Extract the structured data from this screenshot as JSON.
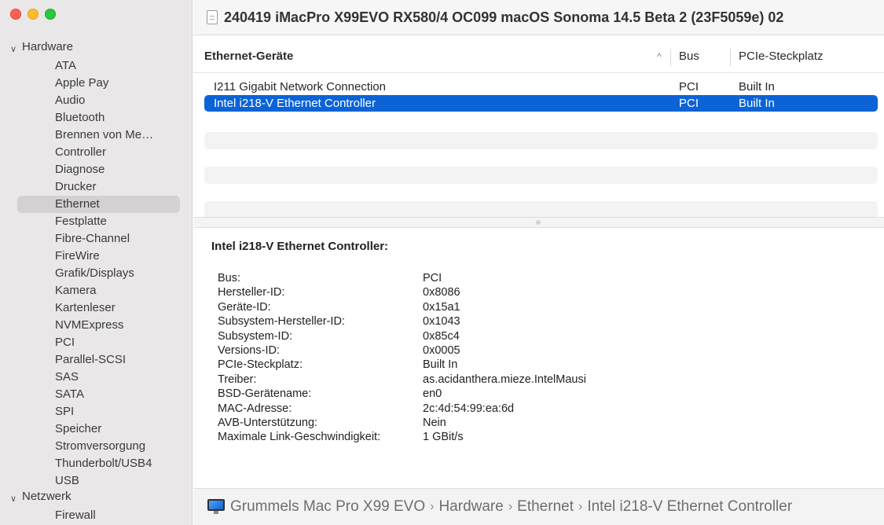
{
  "window": {
    "title": "240419 iMacPro X99EVO RX580/4 OC099 macOS Sonoma 14.5 Beta 2 (23F5059e) 02",
    "traffic_lights": {
      "close": "#fe5f57",
      "minimize": "#febc2e",
      "zoom": "#28c840"
    }
  },
  "sidebar": {
    "groups": [
      {
        "label": "Hardware",
        "expanded": true,
        "items": [
          "ATA",
          "Apple Pay",
          "Audio",
          "Bluetooth",
          "Brennen von Me…",
          "Controller",
          "Diagnose",
          "Drucker",
          "Ethernet",
          "Festplatte",
          "Fibre-Channel",
          "FireWire",
          "Grafik/Displays",
          "Kamera",
          "Kartenleser",
          "NVMExpress",
          "PCI",
          "Parallel-SCSI",
          "SAS",
          "SATA",
          "SPI",
          "Speicher",
          "Stromversorgung",
          "Thunderbolt/USB4",
          "USB"
        ]
      },
      {
        "label": "Netzwerk",
        "expanded": true,
        "items": [
          "Firewall"
        ]
      }
    ],
    "selected": "Ethernet"
  },
  "table": {
    "columns": {
      "name": "Ethernet-Geräte",
      "sort_indicator": "^",
      "bus": "Bus",
      "slot": "PCIe-Steckplatz"
    },
    "rows": [
      {
        "name": "I211 Gigabit Network Connection",
        "bus": "PCI",
        "slot": "Built In",
        "selected": false
      },
      {
        "name": "Intel i218-V Ethernet Controller",
        "bus": "PCI",
        "slot": "Built In",
        "selected": true
      }
    ],
    "selection_color": "#0b63d6"
  },
  "detail": {
    "title": "Intel i218-V Ethernet Controller:",
    "properties": [
      {
        "key": "Bus:",
        "value": "PCI"
      },
      {
        "key": "Hersteller-ID:",
        "value": "0x8086"
      },
      {
        "key": "Geräte-ID:",
        "value": "0x15a1"
      },
      {
        "key": "Subsystem-Hersteller-ID:",
        "value": "0x1043"
      },
      {
        "key": "Subsystem-ID:",
        "value": "0x85c4"
      },
      {
        "key": "Versions-ID:",
        "value": "0x0005"
      },
      {
        "key": "PCIe-Steckplatz:",
        "value": "Built In"
      },
      {
        "key": "Treiber:",
        "value": "as.acidanthera.mieze.IntelMausi"
      },
      {
        "key": "BSD-Gerätename:",
        "value": "en0"
      },
      {
        "key": "MAC-Adresse:",
        "value": "2c:4d:54:99:ea:6d"
      },
      {
        "key": "AVB-Unterstützung:",
        "value": "Nein"
      },
      {
        "key": "Maximale Link-Geschwindigkeit:",
        "value": "1 GBit/s"
      }
    ]
  },
  "pathbar": {
    "icon": "mac-pro-icon",
    "crumbs": [
      "Grummels Mac Pro X99 EVO",
      "Hardware",
      "Ethernet",
      "Intel i218-V Ethernet Controller"
    ],
    "separator": "›"
  }
}
